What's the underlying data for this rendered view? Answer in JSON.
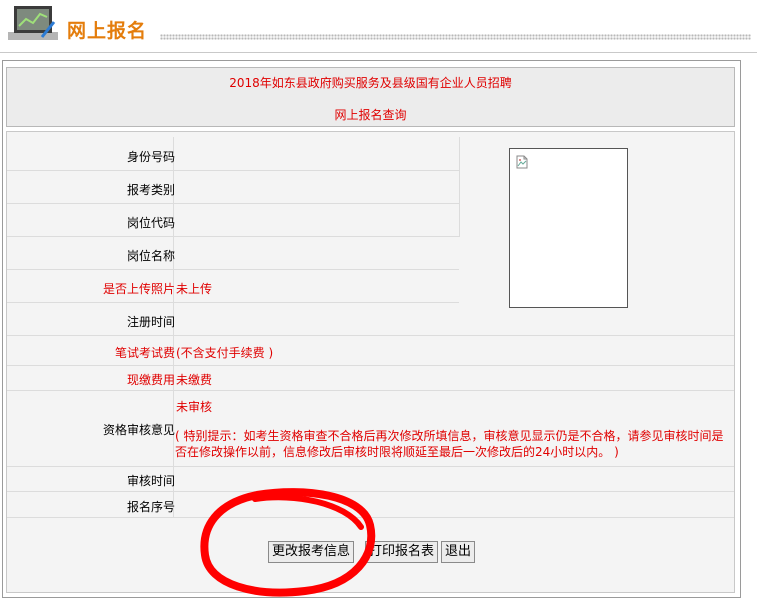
{
  "header": {
    "title": "网上报名",
    "icon": "chart-monitor-icon",
    "title_color": "#e47d0c"
  },
  "title_panel": {
    "line1": "2018年如东县政府购买服务及县级国有企业人员招聘",
    "line2": "网上报名查询"
  },
  "form": {
    "id_number": {
      "label": "身份号码",
      "value": ""
    },
    "category": {
      "label": "报考类别",
      "value": ""
    },
    "position_code": {
      "label": "岗位代码",
      "value": ""
    },
    "position_name": {
      "label": "岗位名称",
      "value": ""
    },
    "photo_uploaded": {
      "label": "是否上传照片",
      "value": "未上传"
    },
    "register_time": {
      "label": "注册时间",
      "value": ""
    },
    "exam_fee": {
      "label": "笔试考试费",
      "value": "(不含支付手续费 )"
    },
    "paid_fee": {
      "label": "现缴费用",
      "value": "未缴费"
    },
    "review": {
      "label": "资格审核意见",
      "value": "未审核",
      "note": "( 特别提示：如考生资格审查不合格后再次修改所填信息，审核意见显示仍是不合格，请参见审核时间是否在修改操作以前，信息修改后审核时限将顺延至最后一次修改后的24小时以内。 )"
    },
    "review_time": {
      "label": "审核时间",
      "value": ""
    },
    "serial_no": {
      "label": "报名序号",
      "value": ""
    }
  },
  "photo": {
    "icon": "broken-image-icon"
  },
  "buttons": {
    "edit": "更改报考信息",
    "print": "打印报名表",
    "exit": "退出"
  },
  "colors": {
    "accent_red": "#e00000",
    "annotation": "#ff0000"
  }
}
